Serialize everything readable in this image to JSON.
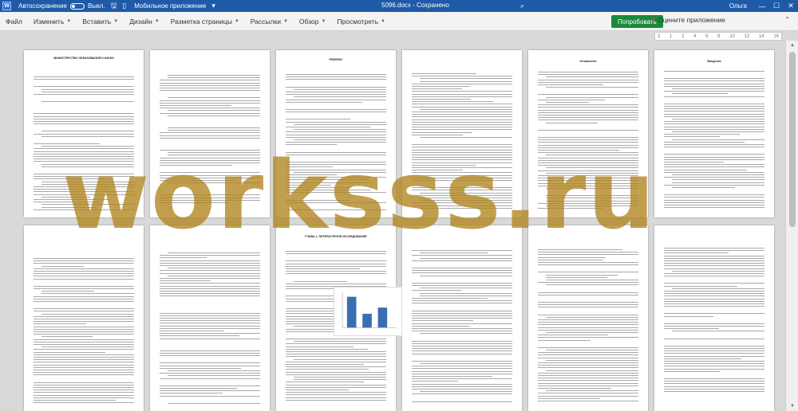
{
  "titlebar": {
    "autosave_label": "Автосохранение",
    "autosave_state": "Выкл.",
    "app_name": "Мобильное приложение",
    "document_title": "5096.docx - Сохранено",
    "user": "Ольга"
  },
  "menu": [
    {
      "label": "Файл"
    },
    {
      "label": "Изменить",
      "dropdown": true
    },
    {
      "label": "Вставить",
      "dropdown": true
    },
    {
      "label": "Дизайн",
      "dropdown": true
    },
    {
      "label": "Разметка страницы",
      "dropdown": true
    },
    {
      "label": "Рассылки",
      "dropdown": true
    },
    {
      "label": "Обзор",
      "dropdown": true
    },
    {
      "label": "Просмотреть",
      "dropdown": true
    }
  ],
  "actions": {
    "promote_label": "Попробовать",
    "rate_label": "Оцените приложение"
  },
  "ruler": {
    "ticks": [
      "2",
      "1",
      "2",
      "4",
      "6",
      "8",
      "10",
      "12",
      "14",
      "16"
    ]
  },
  "page_headings": {
    "p1": "МИНИСТЕРСТВО ОБРАЗОВАНИЯ И НАУКИ",
    "p3": "РЕФЕРАТ",
    "p5": "Оглавление",
    "p6": "Введение",
    "p9": "ГЛАВА 1. ЛИТЕРАТУРНОЕ ИССЛЕДОВАНИЕ"
  },
  "watermark": "worksss.ru",
  "colors": {
    "titlebar": "#1f5aa8",
    "promote": "#1b8a3c",
    "watermark": "#b0841e"
  }
}
